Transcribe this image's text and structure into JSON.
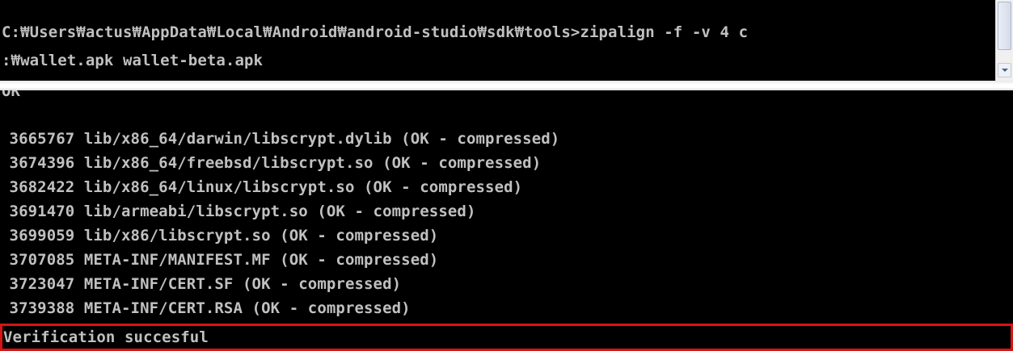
{
  "top_console": {
    "command_line_1": "C:₩Users₩actus₩AppData₩Local₩Android₩android-studio₩sdk₩tools>zipalign -f -v 4 c",
    "command_line_2": ":₩wallet.apk wallet-beta.apk"
  },
  "scrollbar": {
    "thumb_icon": "scroll-thumb",
    "down_icon": "chevron-down-icon"
  },
  "output": {
    "clipped_line": "OK",
    "lines": [
      " 3665767 lib/x86_64/darwin/libscrypt.dylib (OK - compressed)",
      " 3674396 lib/x86_64/freebsd/libscrypt.so (OK - compressed)",
      " 3682422 lib/x86_64/linux/libscrypt.so (OK - compressed)",
      " 3691470 lib/armeabi/libscrypt.so (OK - compressed)",
      " 3699059 lib/x86/libscrypt.so (OK - compressed)",
      " 3707085 META-INF/MANIFEST.MF (OK - compressed)",
      " 3723047 META-INF/CERT.SF (OK - compressed)",
      " 3739388 META-INF/CERT.RSA (OK - compressed)"
    ],
    "verification": "Verification succesful",
    "highlight_color": "#d71414"
  },
  "colors": {
    "console_background": "#000000",
    "console_text": "#c0c0c0"
  }
}
